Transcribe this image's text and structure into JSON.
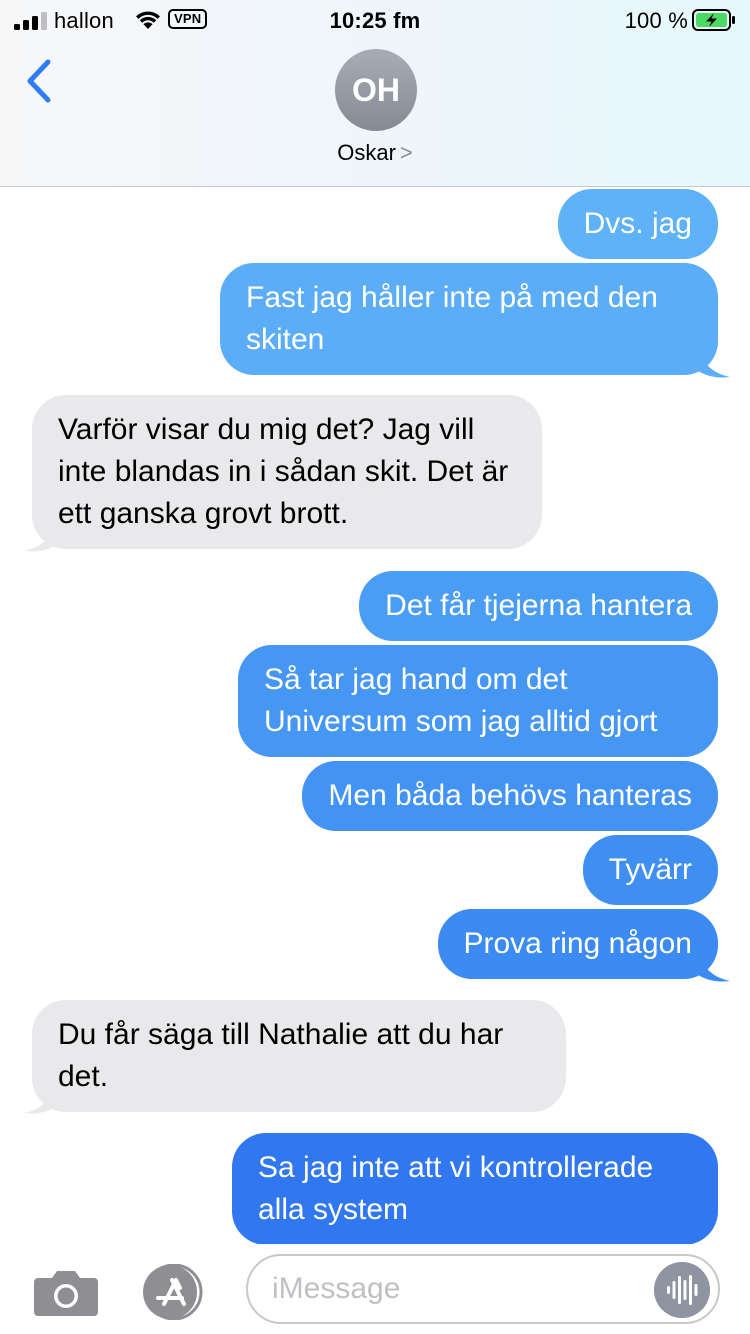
{
  "status": {
    "carrier": "hallon",
    "vpn": "VPN",
    "time": "10:25 fm",
    "battery_percent": "100 %"
  },
  "header": {
    "avatar_initials": "OH",
    "contact_name": "Oskar",
    "contact_chevron": ">"
  },
  "messages": [
    {
      "dir": "out",
      "text": "Dvs. jag"
    },
    {
      "dir": "out",
      "text": "Fast jag håller inte på med den skiten"
    },
    {
      "dir": "in",
      "text": "Varför visar du mig det? Jag vill inte blandas in i sådan skit. Det är ett ganska grovt brott."
    },
    {
      "dir": "out",
      "text": "Det får tjejerna hantera"
    },
    {
      "dir": "out",
      "text": "Så tar jag hand om det Universum som jag alltid gjort"
    },
    {
      "dir": "out",
      "text": "Men båda behövs hanteras"
    },
    {
      "dir": "out",
      "text": "Tyvärr"
    },
    {
      "dir": "out",
      "text": "Prova ring någon"
    },
    {
      "dir": "in",
      "text": "Du får säga till Nathalie att du har det."
    },
    {
      "dir": "out",
      "text": "Sa jag inte att vi kontrollerade alla system"
    }
  ],
  "composer": {
    "placeholder": "iMessage"
  },
  "colors": {
    "outgoing_top": "#5fb1f8",
    "outgoing_mid": "#3d8ff2",
    "outgoing_bottom": "#2f76f0",
    "incoming": "#e9e9eb",
    "accent": "#2f7cf6"
  },
  "icons": [
    "back-chevron-icon",
    "camera-icon",
    "app-store-icon",
    "audio-waveform-icon",
    "wifi-icon",
    "signal-icon",
    "battery-charging-icon"
  ]
}
